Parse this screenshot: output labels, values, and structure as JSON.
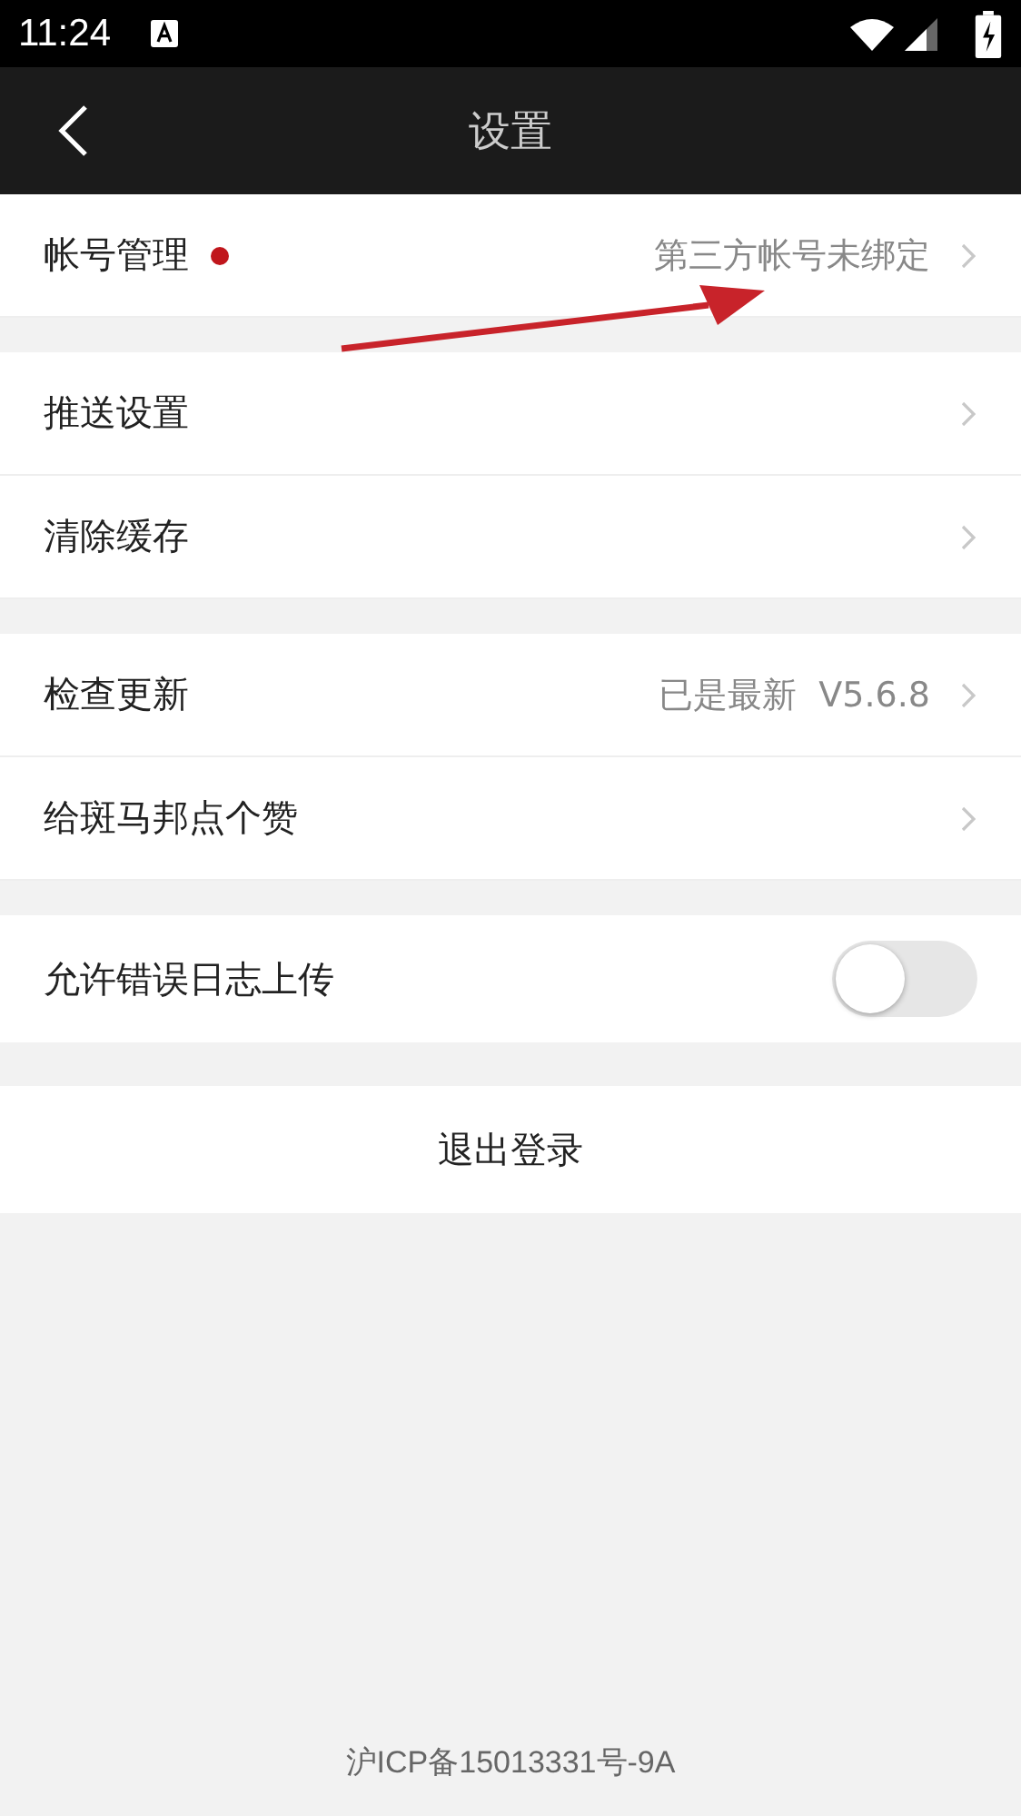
{
  "status_bar": {
    "time": "11:24"
  },
  "header": {
    "title": "设置"
  },
  "groups": [
    {
      "rows": [
        {
          "kind": "link",
          "label": "帐号管理",
          "dot": true,
          "value": "第三方帐号未绑定"
        }
      ]
    },
    {
      "rows": [
        {
          "kind": "link",
          "label": "推送设置",
          "dot": false
        },
        {
          "kind": "link",
          "label": "清除缓存",
          "dot": false
        }
      ]
    },
    {
      "rows": [
        {
          "kind": "link",
          "label": "检查更新",
          "dot": false,
          "value": "已是最新  V5.6.8"
        },
        {
          "kind": "link",
          "label": "给斑马邦点个赞",
          "dot": false
        }
      ]
    },
    {
      "rows": [
        {
          "kind": "toggle",
          "label": "允许错误日志上传",
          "dot": false,
          "on": false
        }
      ]
    }
  ],
  "logout": {
    "label": "退出登录"
  },
  "footer": "沪ICP备15013331号-9A"
}
